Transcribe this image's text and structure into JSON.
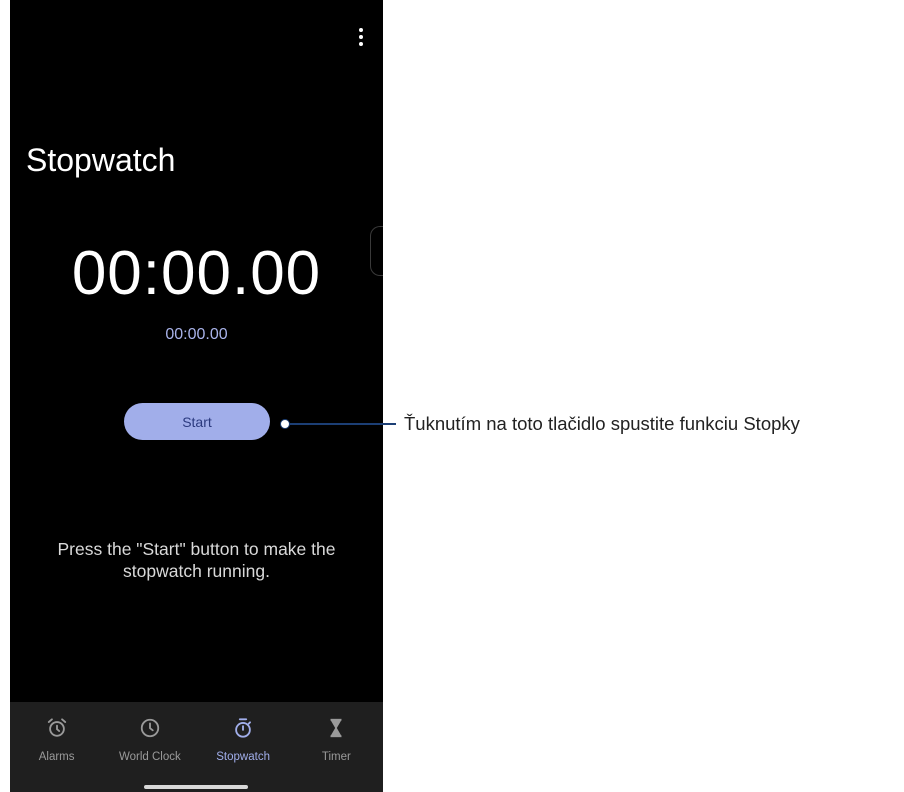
{
  "app": {
    "page_title": "Stopwatch",
    "main_time": "00:00.00",
    "lap_time": "00:00.00",
    "start_label": "Start",
    "hint_text": "Press the \"Start\" button to make the stopwatch running."
  },
  "nav": {
    "items": [
      {
        "label": "Alarms",
        "icon": "alarm-clock-icon"
      },
      {
        "label": "World Clock",
        "icon": "clock-icon"
      },
      {
        "label": "Stopwatch",
        "icon": "stopwatch-icon",
        "active": true
      },
      {
        "label": "Timer",
        "icon": "hourglass-icon"
      }
    ]
  },
  "annotation": {
    "callout_text": "Ťuknutím na toto tlačidlo spustite funkciu Stopky"
  },
  "colors": {
    "background": "#000000",
    "accent": "#a1aeea",
    "nav_background": "#1f1f1f",
    "callout_line": "#1c3f75"
  }
}
